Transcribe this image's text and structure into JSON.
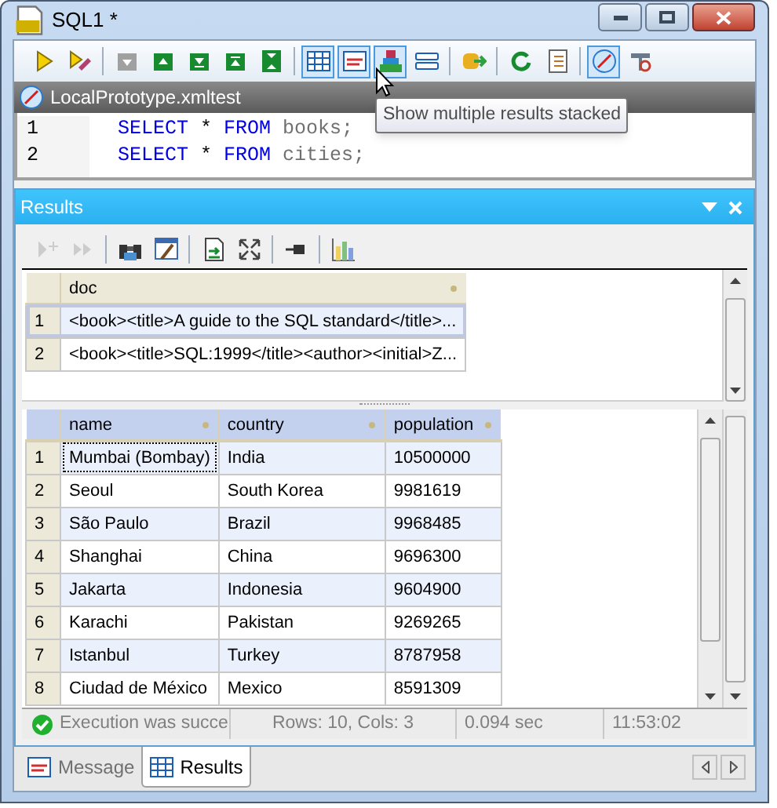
{
  "window": {
    "title": "SQL1 *"
  },
  "toolbar": [
    {
      "kind": "button",
      "highlighted": false
    },
    {
      "kind": "button",
      "highlighted": false
    },
    {
      "kind": "separator"
    },
    {
      "kind": "button",
      "highlighted": false
    },
    {
      "kind": "button",
      "highlighted": false
    },
    {
      "kind": "button",
      "highlighted": false
    },
    {
      "kind": "button",
      "highlighted": false
    },
    {
      "kind": "button",
      "highlighted": false
    },
    {
      "kind": "separator"
    },
    {
      "kind": "button",
      "highlighted": true
    },
    {
      "kind": "button",
      "highlighted": true
    },
    {
      "kind": "button",
      "highlighted": true
    },
    {
      "kind": "button",
      "highlighted": false
    },
    {
      "kind": "separator"
    },
    {
      "kind": "button",
      "highlighted": false
    },
    {
      "kind": "separator"
    },
    {
      "kind": "button",
      "highlighted": false
    },
    {
      "kind": "button",
      "highlighted": false
    },
    {
      "kind": "separator"
    },
    {
      "kind": "button",
      "highlighted": true
    },
    {
      "kind": "button",
      "highlighted": false
    }
  ],
  "tooltip": {
    "text": "Show multiple results stacked"
  },
  "editor_tab": {
    "label": "LocalPrototype.xmltest"
  },
  "editor": {
    "lines": [
      {
        "number": "1",
        "tokens": [
          {
            "kind": "keyword",
            "text": "SELECT"
          },
          {
            "kind": "operator",
            "text": "*"
          },
          {
            "kind": "keyword",
            "text": "FROM"
          },
          {
            "kind": "name",
            "text": "books;"
          }
        ]
      },
      {
        "number": "2",
        "tokens": [
          {
            "kind": "keyword",
            "text": "SELECT"
          },
          {
            "kind": "operator",
            "text": "*"
          },
          {
            "kind": "keyword",
            "text": "FROM"
          },
          {
            "kind": "name",
            "text": "cities;"
          }
        ]
      }
    ]
  },
  "results_panel": {
    "title": "Results",
    "toolbar": [
      {
        "kind": "button",
        "disabled": true
      },
      {
        "kind": "button",
        "disabled": true
      },
      {
        "kind": "separator"
      },
      {
        "kind": "button",
        "disabled": false
      },
      {
        "kind": "button",
        "disabled": false
      },
      {
        "kind": "separator"
      },
      {
        "kind": "button",
        "disabled": false
      },
      {
        "kind": "button",
        "disabled": false
      },
      {
        "kind": "separator"
      },
      {
        "kind": "button",
        "disabled": false
      },
      {
        "kind": "separator"
      },
      {
        "kind": "button",
        "disabled": false
      }
    ],
    "result_sets": [
      {
        "columns": [
          "doc"
        ],
        "rows": [
          {
            "number": "1",
            "selected": true,
            "cells": [
              "<book><title>A guide to the SQL standard</title>..."
            ]
          },
          {
            "number": "2",
            "selected": false,
            "cells": [
              "<book><title>SQL:1999</title><author><initial>Z..."
            ]
          }
        ]
      },
      {
        "columns": [
          "name",
          "country",
          "population"
        ],
        "rows": [
          {
            "number": "1",
            "selected": false,
            "focused": true,
            "cells": [
              "Mumbai (Bombay)",
              "India",
              "10500000"
            ]
          },
          {
            "number": "2",
            "selected": false,
            "focused": false,
            "cells": [
              "Seoul",
              "South Korea",
              "9981619"
            ]
          },
          {
            "number": "3",
            "selected": false,
            "focused": false,
            "cells": [
              "São Paulo",
              "Brazil",
              "9968485"
            ]
          },
          {
            "number": "4",
            "selected": false,
            "focused": false,
            "cells": [
              "Shanghai",
              "China",
              "9696300"
            ]
          },
          {
            "number": "5",
            "selected": false,
            "focused": false,
            "cells": [
              "Jakarta",
              "Indonesia",
              "9604900"
            ]
          },
          {
            "number": "6",
            "selected": false,
            "focused": false,
            "cells": [
              "Karachi",
              "Pakistan",
              "9269265"
            ]
          },
          {
            "number": "7",
            "selected": false,
            "focused": false,
            "cells": [
              "Istanbul",
              "Turkey",
              "8787958"
            ]
          },
          {
            "number": "8",
            "selected": false,
            "focused": false,
            "cells": [
              "Ciudad de México",
              "Mexico",
              "8591309"
            ]
          }
        ]
      }
    ],
    "status_bar": {
      "message": "Execution was succe",
      "rows_cols": "Rows: 10, Cols: 3",
      "duration": "0.094 sec",
      "time": "11:53:02"
    }
  },
  "bottom_tabs": [
    {
      "label": "Message",
      "selected": false
    },
    {
      "label": "Results",
      "selected": true
    }
  ]
}
